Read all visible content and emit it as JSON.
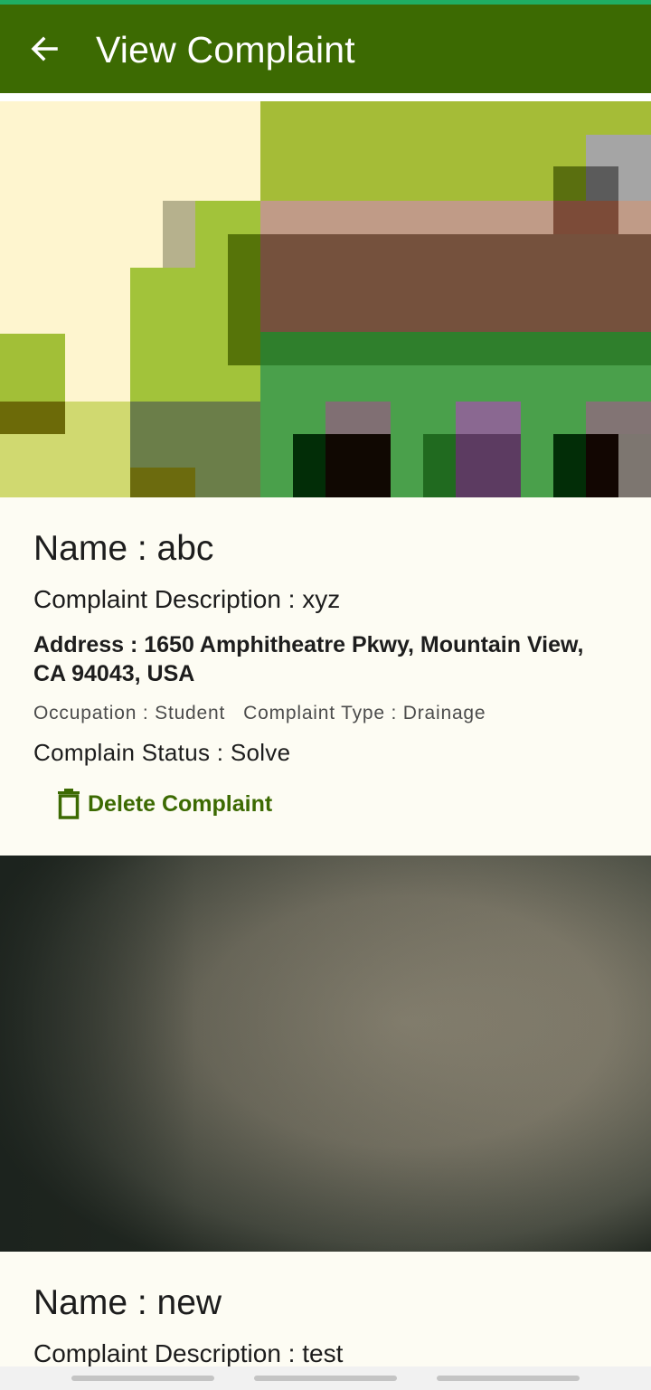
{
  "app_bar": {
    "title": "View Complaint",
    "back_icon": "arrow-left-icon",
    "background": "#3c6a02",
    "status_accent": "#1fae63"
  },
  "complaints": [
    {
      "name": "Name : abc",
      "description": "Complaint Description : xyz",
      "address": "Address : 1650 Amphitheatre Pkwy, Mountain View, CA 94043, USA",
      "occupation": "Occupation : Student",
      "complaint_type": "Complaint Type : Drainage",
      "status": "Complain Status : Solve",
      "delete_label": "Delete Complaint",
      "delete_icon": "trash-icon"
    },
    {
      "name": "Name : new",
      "description": "Complaint Description : test"
    }
  ],
  "theme": {
    "card_background": "#fdfcf3",
    "accent": "#3c6a02"
  }
}
